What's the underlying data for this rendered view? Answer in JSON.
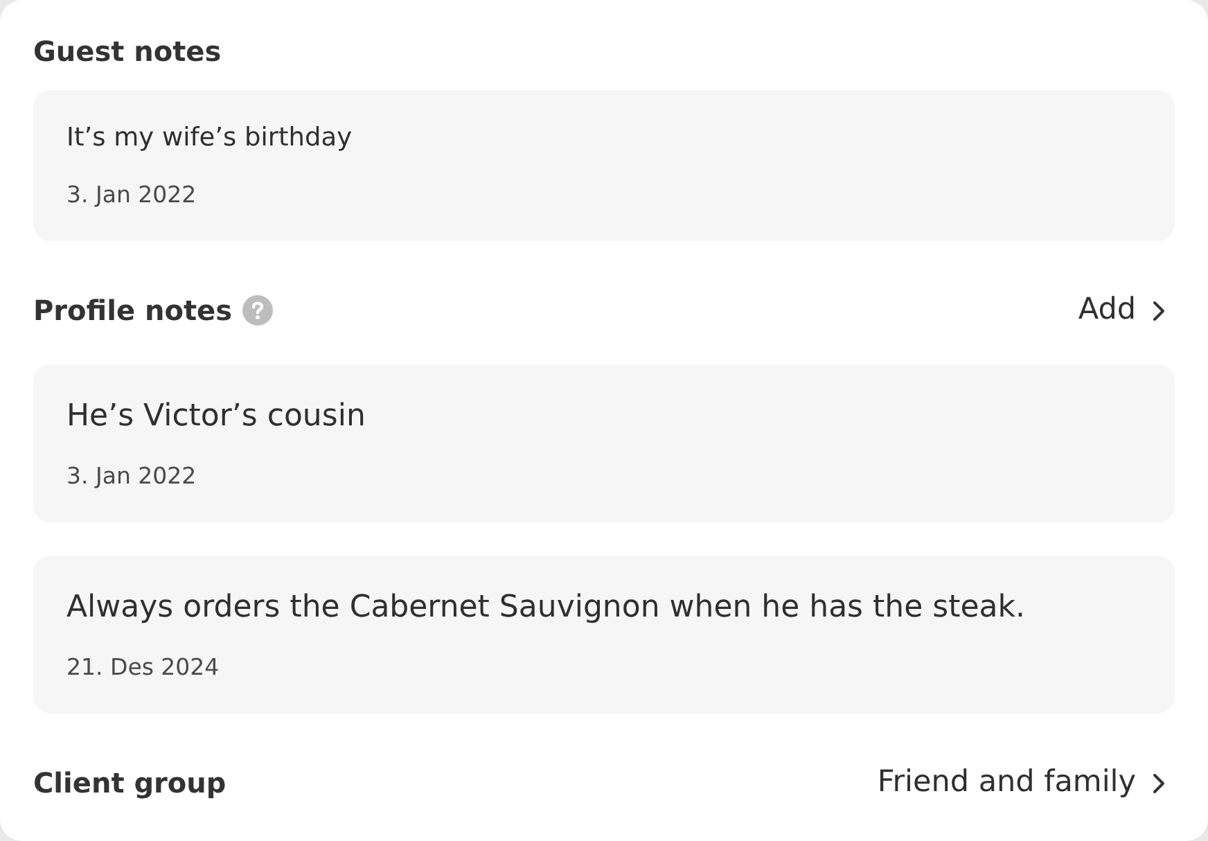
{
  "guest_notes": {
    "title": "Guest notes",
    "notes": [
      {
        "text": "It’s my wife’s birthday",
        "date": "3. Jan 2022"
      }
    ]
  },
  "profile_notes": {
    "title": "Profile notes",
    "action": "Add",
    "notes": [
      {
        "text": "He’s Victor’s cousin",
        "date": "3. Jan 2022"
      },
      {
        "text": "Always orders the Cabernet Sauvignon when he has the steak.",
        "date": "21. Des 2024"
      }
    ]
  },
  "client_group": {
    "label": "Client group",
    "value": "Friend and family"
  }
}
